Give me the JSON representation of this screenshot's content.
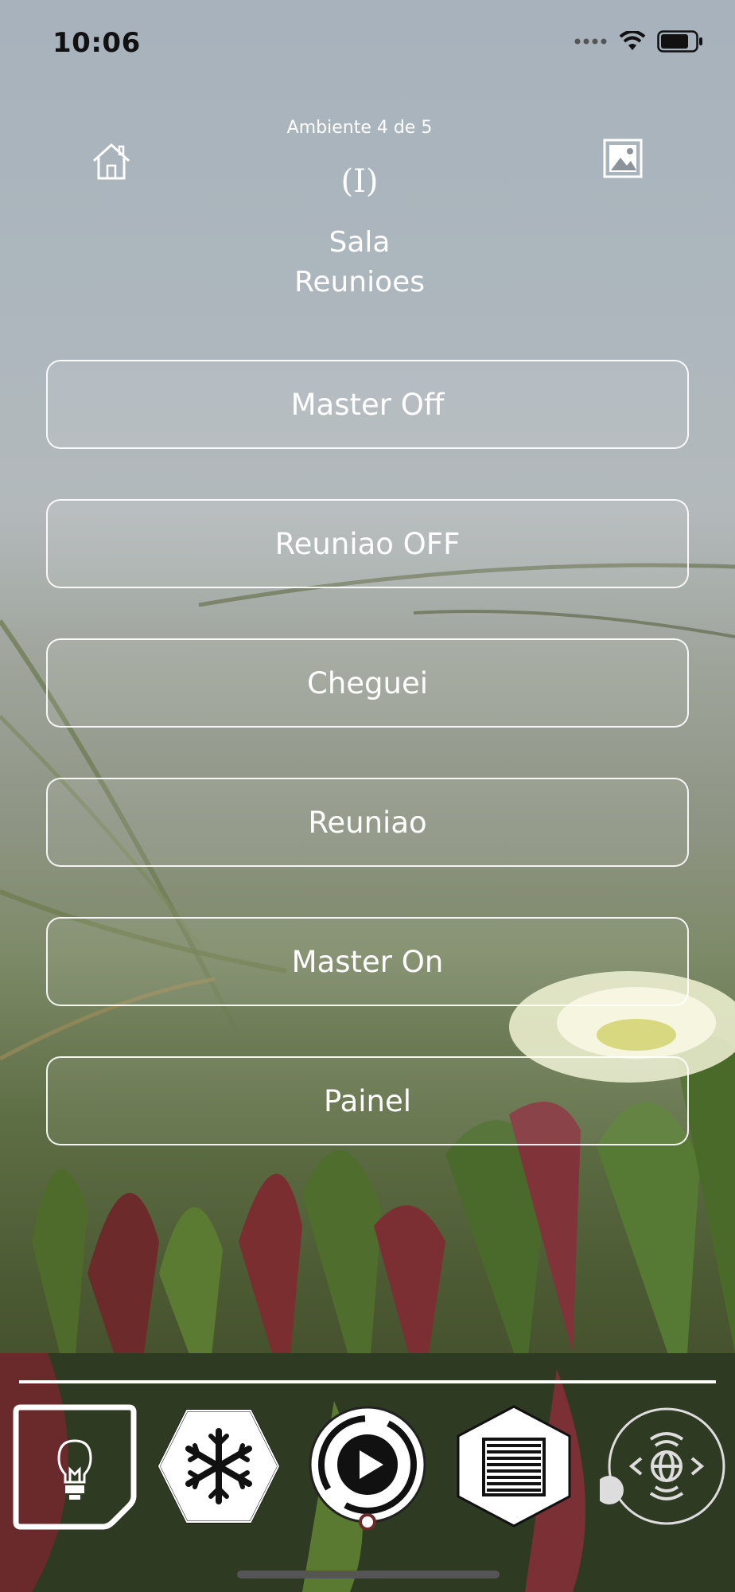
{
  "status_bar": {
    "time": "10:06",
    "icons": [
      "signal-dots-icon",
      "wifi-icon",
      "battery-icon"
    ]
  },
  "header": {
    "ambient_counter": "Ambiente 4 de 5",
    "room_id": "(I)",
    "room_name_line1": "Sala",
    "room_name_line2": "Reunioes",
    "left_icon": "home-icon",
    "right_icon": "image-icon"
  },
  "scenes": [
    {
      "label": "Master Off"
    },
    {
      "label": "Reuniao OFF"
    },
    {
      "label": "Cheguei"
    },
    {
      "label": "Reuniao"
    },
    {
      "label": "Master On"
    },
    {
      "label": "Painel"
    }
  ],
  "bottom_nav": {
    "items": [
      "lightbulb-icon",
      "snowflake-icon",
      "play-icon",
      "blinds-icon",
      "globe-icon"
    ],
    "active": "lightbulb-icon"
  }
}
